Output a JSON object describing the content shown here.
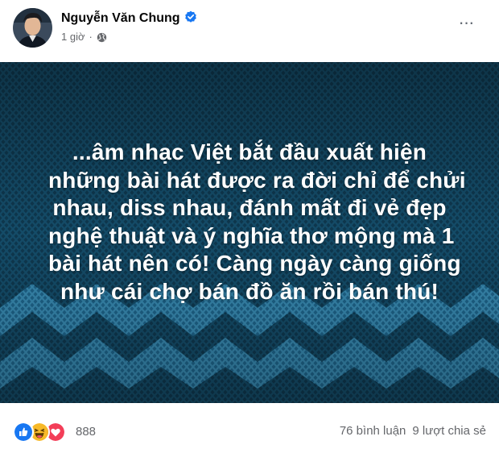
{
  "post": {
    "author_name": "Nguyễn Văn Chung",
    "time": "1 giờ",
    "time_separator": "·"
  },
  "image": {
    "quote_lines": [
      "...âm nhạc Việt bắt đầu xuất hiện",
      "những bài hát được ra đời chỉ để chửi",
      "nhau, diss nhau, đánh mất đi vẻ đẹp",
      "nghệ thuật và ý nghĩa thơ mộng mà 1",
      "bài hát nên có! Càng ngày càng giống",
      "như cái chợ bán đồ ăn rồi bán thú!"
    ],
    "colors": {
      "background": "#0f3a52",
      "pattern": "#2e7ea3",
      "text": "#ffffff"
    }
  },
  "footer": {
    "reaction_icons": [
      "like-icon",
      "haha-icon",
      "love-icon"
    ],
    "reaction_count": "888",
    "comments": "76 bình luận",
    "shares": "9 lượt chia sẻ"
  },
  "colors": {
    "accent": "#1877f2",
    "muted": "#65676b"
  }
}
